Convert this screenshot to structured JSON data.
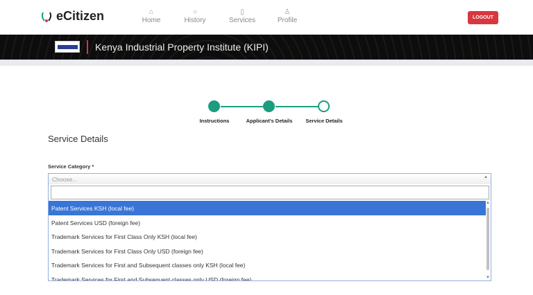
{
  "header": {
    "brand": "eCitizen",
    "nav": [
      {
        "label": "Home",
        "icon": "home-icon"
      },
      {
        "label": "History",
        "icon": "history-icon"
      },
      {
        "label": "Services",
        "icon": "services-icon"
      },
      {
        "label": "Profile",
        "icon": "profile-icon"
      }
    ],
    "logout": "LOGOUT"
  },
  "banner": {
    "title": "Kenya Industrial Property Institute (KIPI)"
  },
  "stepper": {
    "steps": [
      "Instructions",
      "Applicant's Details",
      "Service Details"
    ],
    "completed": 2
  },
  "form": {
    "heading": "Service Details",
    "label": "Service Category *",
    "placeholder": "Choose...",
    "search_value": "",
    "options": [
      "Patent Services KSH (local fee)",
      "Patent Services USD (foreign fee)",
      "Trademark Services for First Class Only KSH (local fee)",
      "Trademark Services for First Class Only USD (foreign fee)",
      "Trademark Services for First and Subsequent classes only KSH (local fee)",
      "Trademark Services for First and Subsequent classes only USD (foreign fee)"
    ],
    "highlighted": 0
  },
  "colors": {
    "accent": "#1a9e7f",
    "logout": "#d9363e",
    "highlight": "#3875d7"
  }
}
